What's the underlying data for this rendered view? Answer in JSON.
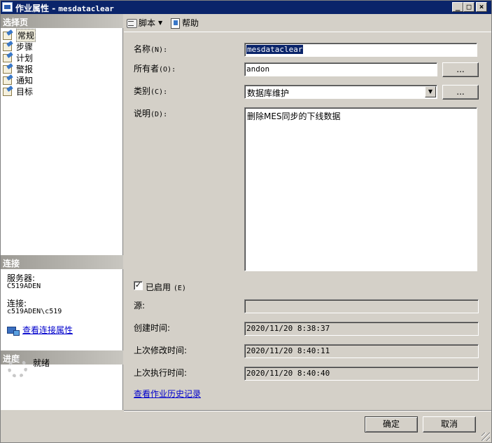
{
  "titlebar": {
    "title_prefix": "作业属性",
    "title_sep": " - ",
    "job_name": "mesdataclear",
    "buttons": {
      "minimize": "_",
      "maximize": "□",
      "close": "×"
    }
  },
  "left": {
    "select_page_header": "选择页",
    "nav_items": [
      {
        "label": "常规",
        "icon": "property-page-icon",
        "selected": true
      },
      {
        "label": "步骤",
        "icon": "property-page-icon"
      },
      {
        "label": "计划",
        "icon": "property-page-icon"
      },
      {
        "label": "警报",
        "icon": "property-page-icon"
      },
      {
        "label": "通知",
        "icon": "property-page-icon"
      },
      {
        "label": "目标",
        "icon": "property-page-icon"
      }
    ],
    "connection_header": "连接",
    "server_label": "服务器:",
    "server_value": "C519ADEN",
    "connection_label": "连接:",
    "connection_value": "c519ADEN\\c519",
    "view_connection_link": "查看连接属性",
    "progress_header": "进度",
    "progress_status": "就绪"
  },
  "toolbar": {
    "script_label": "脚本",
    "help_label": "帮助",
    "icons": {
      "script": "script-icon",
      "help": "help-icon",
      "dropdown": "chevron-down-icon"
    }
  },
  "form": {
    "name_label": "名称",
    "name_hotkey": "(N):",
    "name_value": "mesdataclear",
    "owner_label": "所有者",
    "owner_hotkey": "(O):",
    "owner_value": "andon",
    "browse_label": "...",
    "category_label": "类别",
    "category_hotkey": "(C):",
    "category_value": "数据库维护",
    "description_label": "说明",
    "description_hotkey": "(D):",
    "description_value": "删除MES同步的下线数据",
    "enabled_label": "已启用",
    "enabled_hotkey": "(E)",
    "enabled_checked": true,
    "checkmark": "✓",
    "source_label": "源:",
    "source_value": "",
    "created_label": "创建时间:",
    "created_value": "2020/11/20 8:38:37",
    "modified_label": "上次修改时间:",
    "modified_value": "2020/11/20 8:40:11",
    "executed_label": "上次执行时间:",
    "executed_value": "2020/11/20 8:40:40",
    "history_link": "查看作业历史记录"
  },
  "footer": {
    "ok_label": "确定",
    "cancel_label": "取消"
  }
}
